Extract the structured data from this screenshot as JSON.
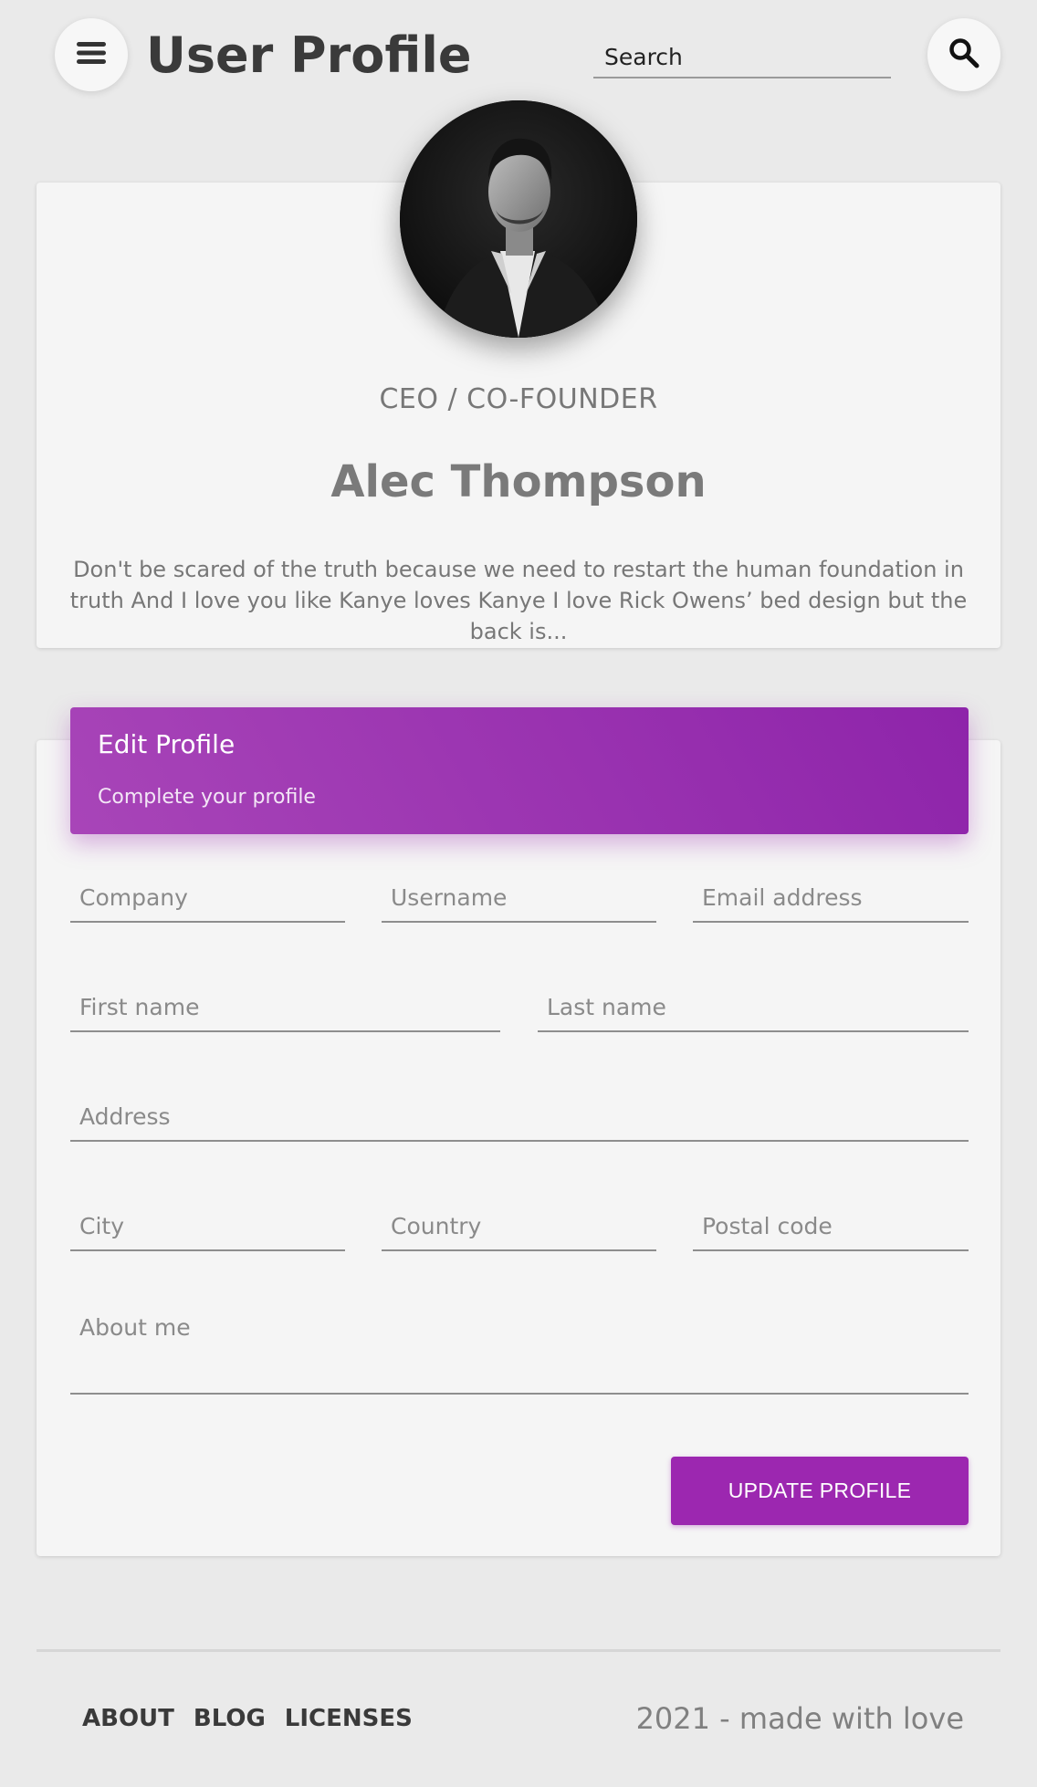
{
  "header": {
    "title": "User Profile",
    "search_placeholder": "Search",
    "menu_icon": "menu-icon",
    "search_icon": "search-icon"
  },
  "profile": {
    "role": "CEO / CO-FOUNDER",
    "name": "Alec Thompson",
    "bio": "Don't be scared of the truth because we need to restart the human foundation in truth And I love you like Kanye loves Kanye I love Rick Owens’ bed design but the back is..."
  },
  "edit_profile": {
    "title": "Edit Profile",
    "subtitle": "Complete your profile",
    "fields": {
      "company": "Company",
      "username": "Username",
      "email": "Email address",
      "first_name": "First name",
      "last_name": "Last name",
      "address": "Address",
      "city": "City",
      "country": "Country",
      "postal_code": "Postal code",
      "about_me": "About me"
    },
    "submit_label": "UPDATE PROFILE"
  },
  "footer": {
    "links": [
      "ABOUT",
      "BLOG",
      "LICENSES"
    ],
    "copyright": "2021 - made with love"
  },
  "colors": {
    "accent": "#9c27b0",
    "background": "#eaeaea",
    "card": "#f5f5f5"
  }
}
